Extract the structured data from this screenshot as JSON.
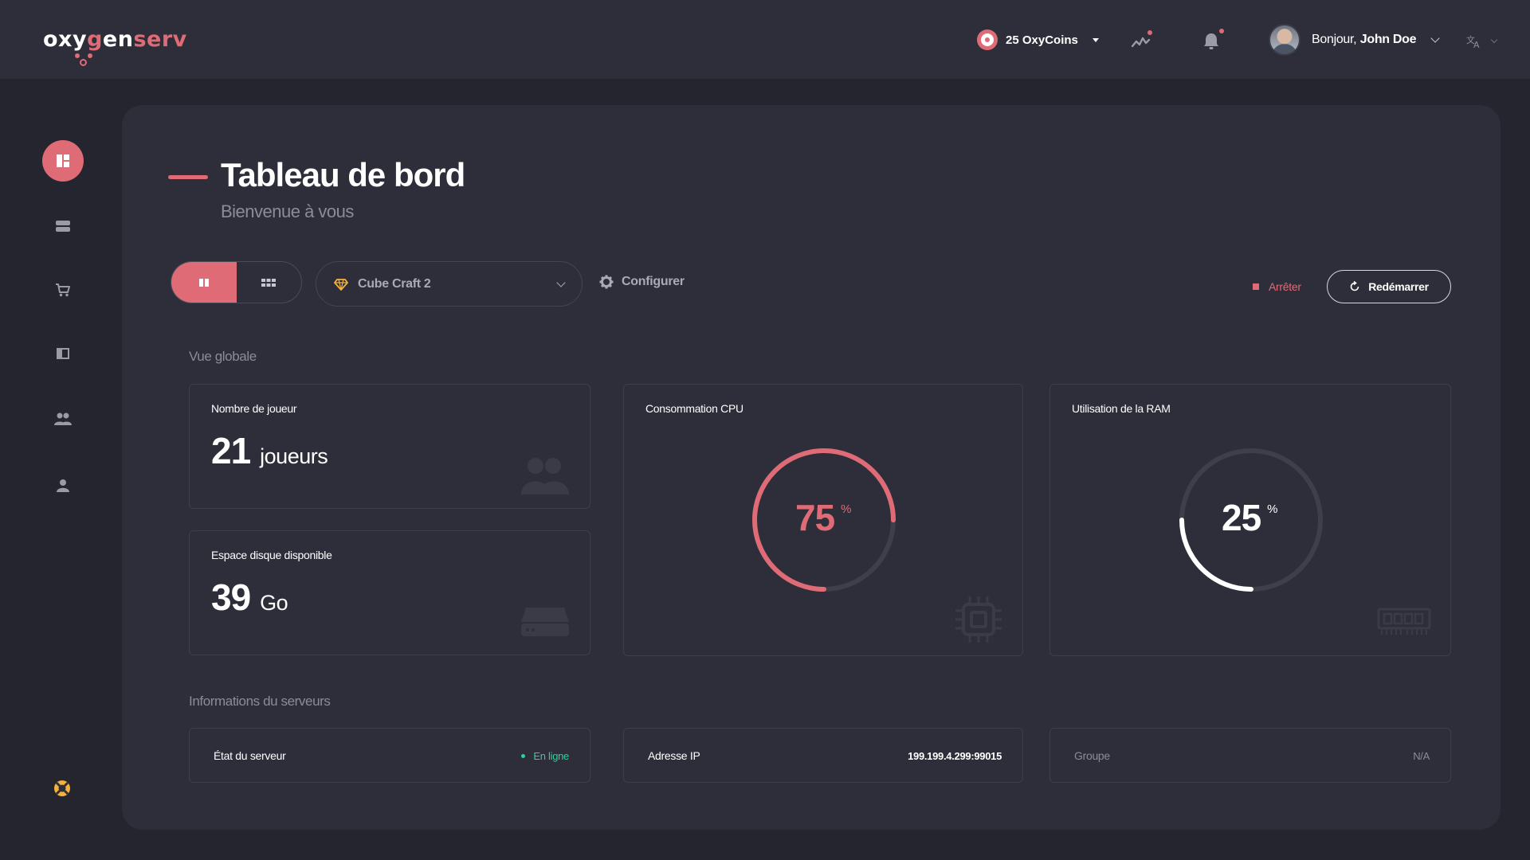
{
  "brand": {
    "logo_prefix": "oxy",
    "logo_g": "g",
    "logo_mid": "en",
    "logo_suffix": "serv"
  },
  "header": {
    "coins_label": "25 OxyCoins",
    "greeting": "Bonjour,",
    "user_name": "John Doe",
    "lang_icon": "translate-icon"
  },
  "sidebar": {
    "items": [
      {
        "name": "dashboard",
        "icon": "dashboard-icon",
        "active": true
      },
      {
        "name": "servers",
        "icon": "server-icon",
        "active": false
      },
      {
        "name": "shop",
        "icon": "cart-icon",
        "active": false
      },
      {
        "name": "docs",
        "icon": "book-icon",
        "active": false
      },
      {
        "name": "team",
        "icon": "users-icon",
        "active": false
      },
      {
        "name": "account",
        "icon": "user-icon",
        "active": false
      }
    ],
    "support_icon": "lifebuoy-icon"
  },
  "page": {
    "title": "Tableau de bord",
    "subtitle": "Bienvenue à vous"
  },
  "toolbar": {
    "selected_server": "Cube Craft 2",
    "configure_label": "Configurer",
    "stop_label": "Arrêter",
    "restart_label": "Redémarrer"
  },
  "overview": {
    "section_label": "Vue globale",
    "players": {
      "title": "Nombre de joueur",
      "value": "21",
      "unit": "joueurs"
    },
    "disk": {
      "title": "Espace disque disponible",
      "value": "39",
      "unit": "Go"
    },
    "cpu": {
      "title": "Consommation CPU",
      "value": "75",
      "unit": "%",
      "percent": 75
    },
    "ram": {
      "title": "Utilisation de la RAM",
      "value": "25",
      "unit": "%",
      "percent": 25
    }
  },
  "server_info": {
    "section_label": "Informations du serveurs",
    "status": {
      "label": "État du serveur",
      "value": "En ligne"
    },
    "ip": {
      "label": "Adresse IP",
      "value": "199.199.4.299:99015"
    },
    "group": {
      "label": "Groupe",
      "value": "N/A"
    }
  },
  "colors": {
    "accent": "#df6b76",
    "online": "#2fd19a",
    "panel": "#2d2e39",
    "background": "#24252e"
  }
}
